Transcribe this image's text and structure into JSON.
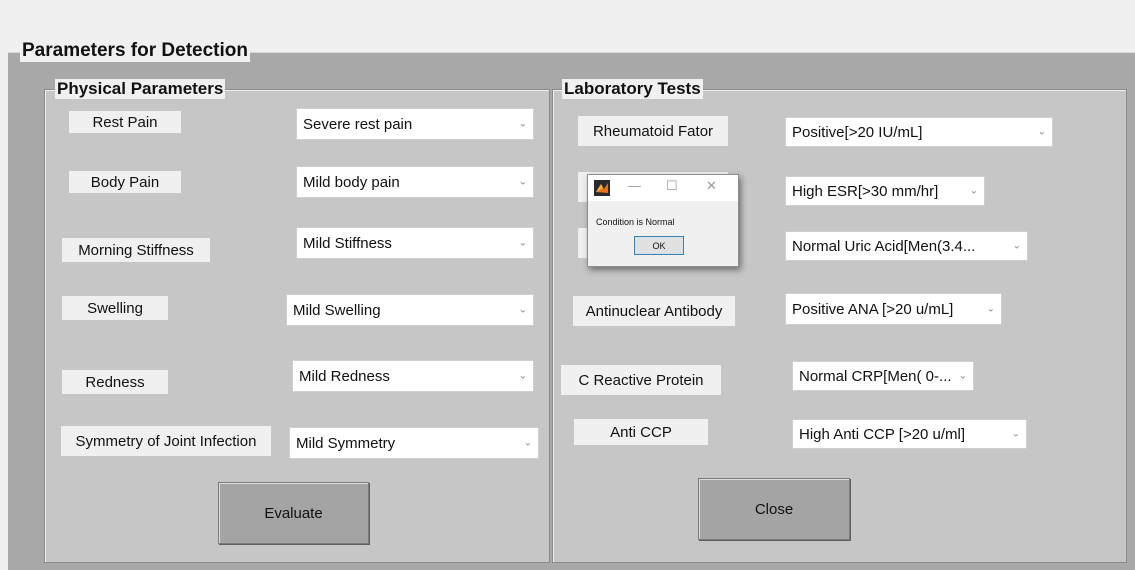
{
  "panel": {
    "title": "Parameters for Detection"
  },
  "physical": {
    "title": "Physical Parameters",
    "rest_pain": {
      "label": "Rest Pain",
      "value": "Severe rest pain"
    },
    "body_pain": {
      "label": "Body Pain",
      "value": "Mild body pain"
    },
    "morning_stiffness": {
      "label": "Morning Stiffness",
      "value": "Mild Stiffness"
    },
    "swelling": {
      "label": "Swelling",
      "value": "Mild Swelling"
    },
    "redness": {
      "label": "Redness",
      "value": "Mild Redness"
    },
    "symmetry": {
      "label": "Symmetry of Joint Infection",
      "value": "Mild Symmetry"
    },
    "evaluate_label": "Evaluate"
  },
  "lab": {
    "title": "Laboratory  Tests",
    "rheumatoid": {
      "label": "Rheumatoid Fator",
      "value": "Positive[>20 IU/mL]"
    },
    "esr": {
      "value": "High ESR[>30 mm/hr]"
    },
    "uric_acid": {
      "value": "Normal Uric Acid[Men(3.4..."
    },
    "ana": {
      "label": "Antinuclear Antibody",
      "value": "Positive ANA [>20 u/mL]"
    },
    "crp": {
      "label": "C Reactive Protein",
      "value": "Normal CRP[Men( 0-..."
    },
    "anti_ccp": {
      "label": "Anti CCP",
      "value": "High Anti CCP [>20 u/ml]"
    },
    "close_label": "Close"
  },
  "dialog": {
    "message": "Condition is Normal",
    "ok_label": "OK",
    "minimize_glyph": "—",
    "maximize_glyph": "☐",
    "close_glyph": "✕"
  },
  "icons": {
    "dropdown_arrow": "chevron-down-icon",
    "dropdown_arrow_glyph": "⌄",
    "app_icon": "matlab-icon"
  }
}
